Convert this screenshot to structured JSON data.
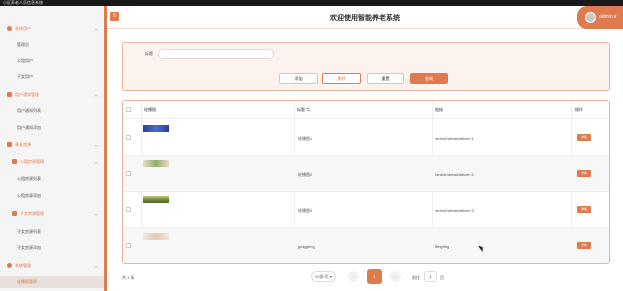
{
  "window": {
    "title": "小区养老人员信息系统"
  },
  "header": {
    "title": "欢迎使用智能养老系统",
    "menu_icon": "≡",
    "user": "admin"
  },
  "sidebar": {
    "sections": [
      {
        "label": "系统用户",
        "items": [
          "管理员",
          "公租用户",
          "子女用户"
        ]
      },
      {
        "label": "用户通知管理",
        "items": [
          "用户通知列表",
          "用户通知添加"
        ]
      },
      {
        "label": "家长房源",
        "groups": [
          {
            "label": "公租房源管理",
            "items": [
              "公租房源列表",
              "公租房源添加"
            ]
          },
          {
            "label": "子女房源管理",
            "items": [
              "子女房源列表",
              "子女房源添加"
            ]
          }
        ]
      },
      {
        "label": "系统管理",
        "items": [
          "轮播图管理"
        ]
      }
    ]
  },
  "search": {
    "label": "标题",
    "placeholder": ""
  },
  "buttons": {
    "add": "添加",
    "delete": "删除",
    "reset": "重置",
    "query": "查询"
  },
  "table": {
    "columns": [
      "轮播图",
      "标题",
      "链接",
      "操作"
    ],
    "rows": [
      {
        "title": "轮播图1",
        "link": "/article/detail/article=1",
        "action": "详情"
      },
      {
        "title": "轮播图2",
        "link": "/article/detail/article=2",
        "action": "详情"
      },
      {
        "title": "轮播图3",
        "link": "/article/detail/article=3",
        "action": "详情"
      },
      {
        "title": "gfdggfmg",
        "link": "fffngffng",
        "action": "详情"
      }
    ]
  },
  "pager": {
    "total": "共 4 条",
    "size": "10条/页",
    "prev": "<",
    "current": "1",
    "next": ">",
    "goto": "前往",
    "goto_value": "1",
    "page": "页"
  },
  "colors": {
    "accent": "#e07a4f"
  }
}
